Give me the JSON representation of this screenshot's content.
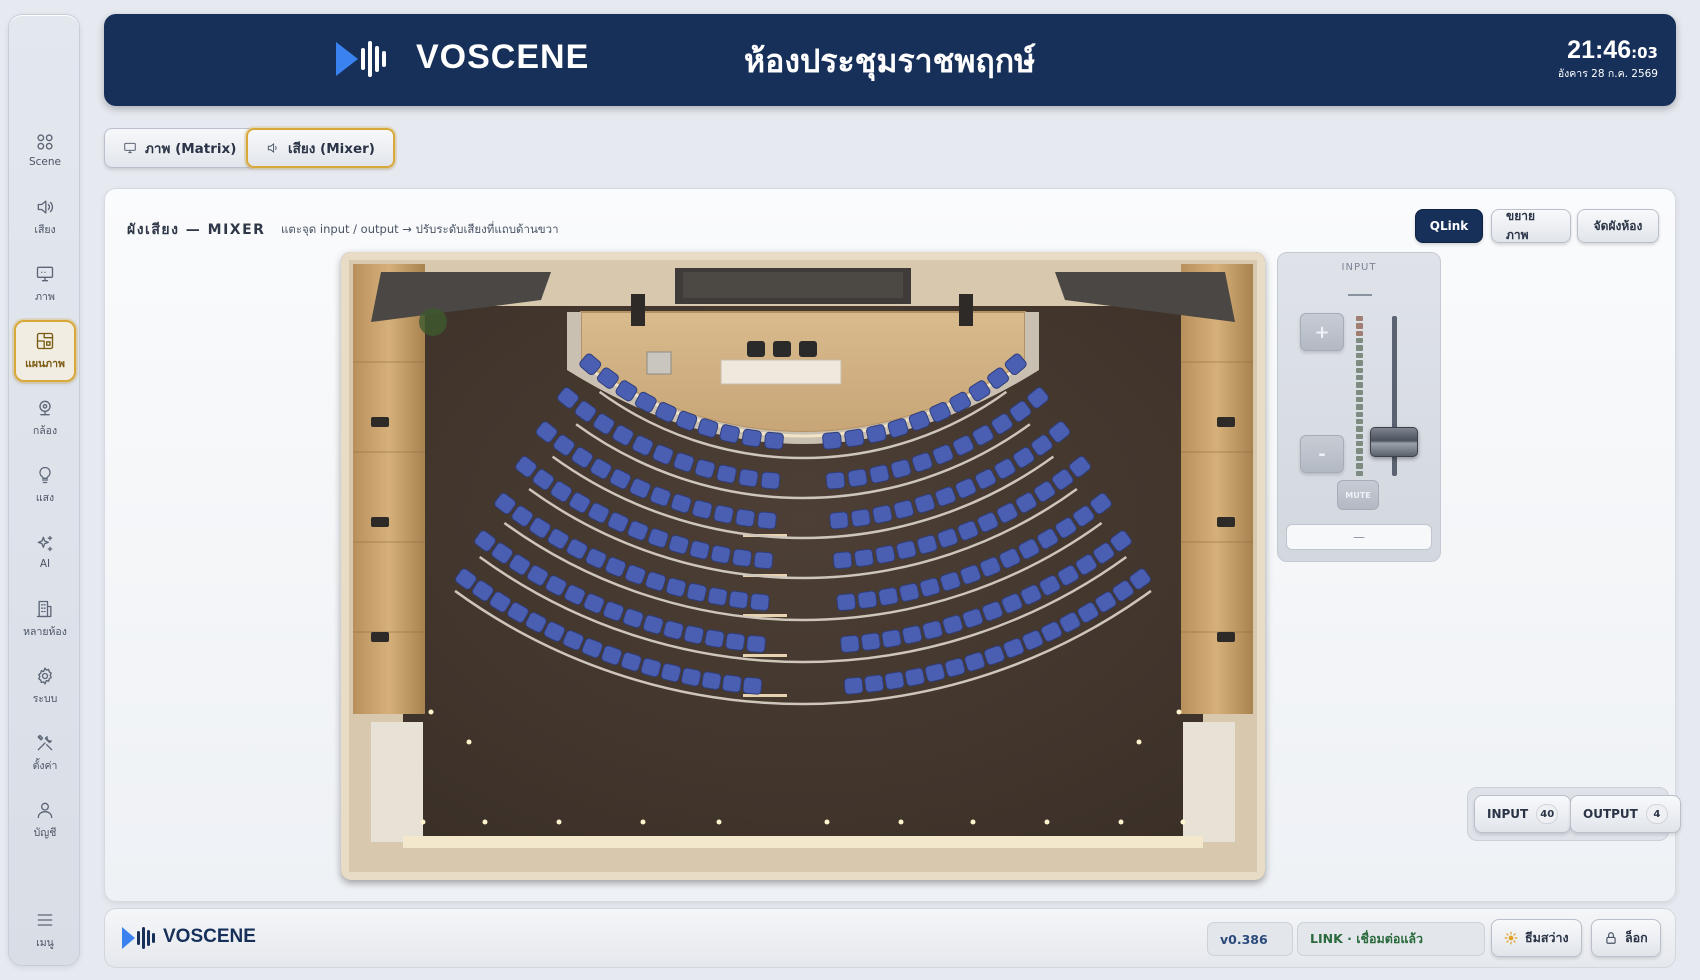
{
  "header": {
    "brand": "VOSCENE",
    "room_title": "ห้องประชุมราชพฤกษ์",
    "time": "21:46",
    "seconds": ":03",
    "date": "อังคาร 28 ก.ค. 2569"
  },
  "sidebar": {
    "items": [
      {
        "label": "Scene",
        "icon": "grid-icon"
      },
      {
        "label": "เสียง",
        "icon": "speaker-icon"
      },
      {
        "label": "ภาพ",
        "icon": "monitor-icon"
      },
      {
        "label": "แผนภาพ",
        "icon": "floorplan-icon"
      },
      {
        "label": "กล้อง",
        "icon": "camera-icon"
      },
      {
        "label": "แสง",
        "icon": "lightbulb-icon"
      },
      {
        "label": "AI",
        "icon": "sparkle-icon"
      },
      {
        "label": "หลายห้อง",
        "icon": "building-icon"
      },
      {
        "label": "ระบบ",
        "icon": "gear-icon"
      },
      {
        "label": "ตั้งค่า",
        "icon": "tools-icon"
      },
      {
        "label": "บัญชี",
        "icon": "user-icon"
      }
    ],
    "menu_label": "เมนู"
  },
  "tabs": {
    "matrix": "ภาพ (Matrix)",
    "mixer": "เสียง (Mixer)"
  },
  "panel": {
    "title": "ผังเสียง — MIXER",
    "hint": "แตะจุด input / output → ปรับระดับเสียงที่แถบด้านขวา",
    "qlink": "QLink",
    "zoom": "ขยายภาพ",
    "arrange": "จัดผังห้อง"
  },
  "strip": {
    "title": "INPUT",
    "plus": "+",
    "minus": "-",
    "mute": "MUTE",
    "value": "—",
    "fader_level": 0.15
  },
  "counts": {
    "input_label": "INPUT",
    "input_count": "40",
    "output_label": "OUTPUT",
    "output_count": "4"
  },
  "footer": {
    "brand": "VOSCENE",
    "version": "v0.386",
    "link_status": "LINK · เชื่อมต่อแล้ว",
    "theme": "ธีมสว่าง",
    "lock": "ล็อก"
  }
}
